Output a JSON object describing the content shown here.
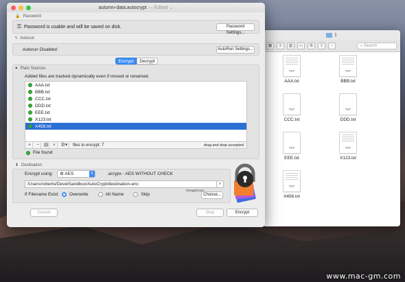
{
  "window": {
    "title": "autumn-data.autocrypt",
    "edited": "— Edited ⌄"
  },
  "password": {
    "header": "Password",
    "status": "Password is usable and will be saved on disk.",
    "settings_button": "Password Settings..."
  },
  "autorun": {
    "header": "Autorun",
    "status": "Autorun Disabled",
    "settings_button": "AutoRun Settings..."
  },
  "mode_tabs": {
    "encrypt": "Encrypt",
    "decrypt": "Decrypt"
  },
  "sources": {
    "header": "Plain Sources",
    "note": "Added files are tracked dynamically  even if moved or renamed.",
    "files": [
      "AAA.txt",
      "BBB.txt",
      "CCC.txt",
      "DDD.txt",
      "EEE.txt",
      "X123.txt",
      "X456.txt"
    ],
    "selected_index": 6,
    "files_to_encrypt": "files to encrypt: 7",
    "drag_note": "drag and drop accepted",
    "file_status": "File found"
  },
  "destination": {
    "header": "Destination",
    "encrypt_using_label": "Encrypt using:",
    "algorithm": "AES",
    "algorithm_note": ".acrypx - AES WITHOUT CHECK",
    "path": "/Users/roberto/DevelSandbox/AutoCrypt/destination-enc",
    "drag_drop_hint": "<Drag&Drop>",
    "exist_label": "If Filename Exist:",
    "options": [
      "Overwrite",
      "Alt Name",
      "Skip"
    ],
    "selected_option": "Overwrite",
    "choose_button": "Choose..."
  },
  "buttons": {
    "cancel": "Cancel",
    "stop": "Stop",
    "encrypt": "Encrypt"
  },
  "finder": {
    "title": "1",
    "search_placeholder": "Search",
    "files": [
      {
        "name": "AAA.txt",
        "ext": "TXT"
      },
      {
        "name": "BBB.txt",
        "ext": "TXT"
      },
      {
        "name": "CCC.txt",
        "ext": "TXT"
      },
      {
        "name": "DDD.txt",
        "ext": "TXT"
      },
      {
        "name": "EEE.txt",
        "ext": "TXT"
      },
      {
        "name": "X123.txt",
        "ext": "TXT"
      },
      {
        "name": "X456.txt",
        "ext": "TXT"
      }
    ]
  },
  "watermark": "www.mac-gm.com",
  "colors": {
    "accent": "#3d8ef7",
    "selection": "#2b6fd6",
    "status_green": "#3aac3a"
  }
}
